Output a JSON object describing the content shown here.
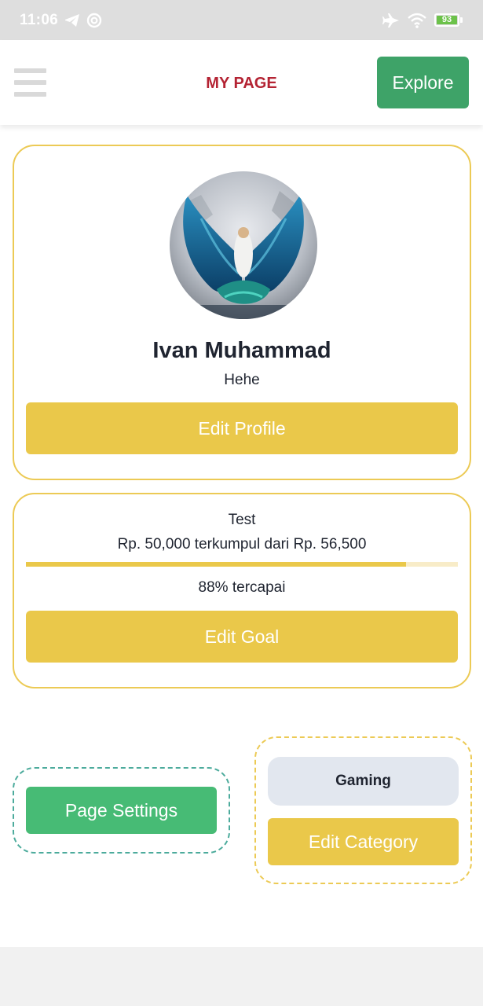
{
  "status_bar": {
    "time": "11:06",
    "battery": "93",
    "left_icons": [
      "telegram-icon",
      "at-sign-icon"
    ],
    "right_icons": [
      "airplane-icon",
      "wifi-icon",
      "battery-icon"
    ]
  },
  "header": {
    "title": "MY PAGE",
    "explore_label": "Explore",
    "menu_icon": "hamburger-menu-icon"
  },
  "profile": {
    "name": "Ivan Muhammad",
    "bio": "Hehe",
    "edit_label": "Edit Profile"
  },
  "goal": {
    "title": "Test",
    "amount_text": "Rp. 50,000 terkumpul dari Rp. 56,500",
    "progress_percent": 88,
    "percent_text": "88% tercapai",
    "edit_label": "Edit Goal"
  },
  "settings": {
    "page_settings_label": "Page Settings"
  },
  "category": {
    "value": "Gaming",
    "edit_label": "Edit Category"
  },
  "colors": {
    "title_red": "#b42333",
    "explore_green": "#3ea368",
    "settings_green": "#47bb75",
    "accent_yellow": "#eac84a",
    "card_border": "#ecca55",
    "dashed_teal": "#4cab9c"
  }
}
